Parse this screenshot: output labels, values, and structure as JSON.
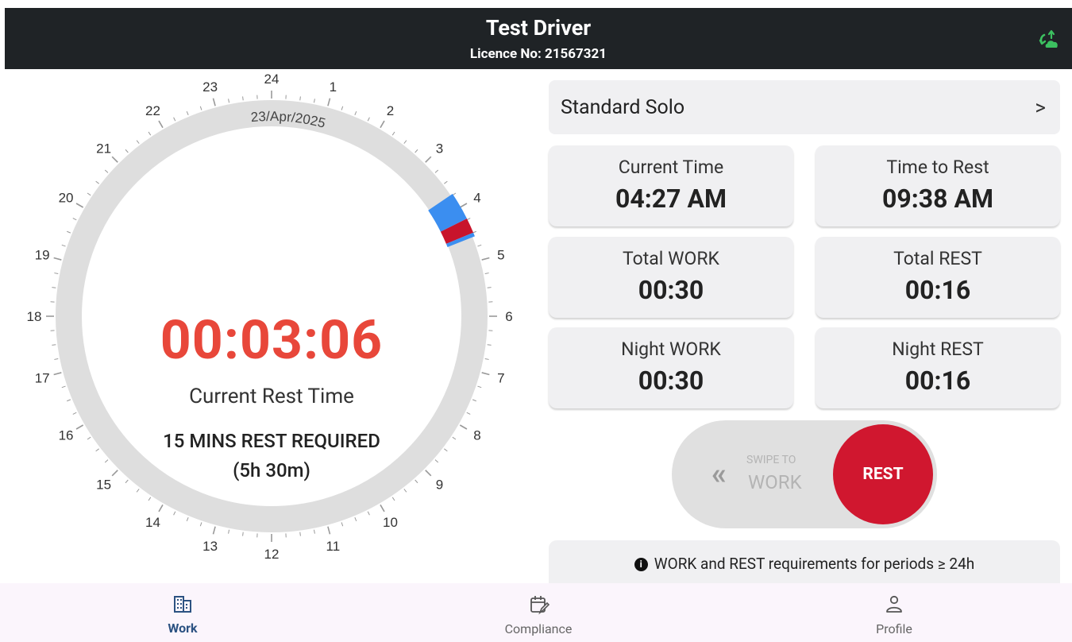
{
  "header": {
    "driver_name": "Test Driver",
    "licence": "Licence No: 21567321",
    "sync_icon": "cloud-sync-icon"
  },
  "dial": {
    "date": "23/Apr/2025",
    "hour_labels": [
      "24",
      "1",
      "2",
      "3",
      "4",
      "5",
      "6",
      "7",
      "8",
      "9",
      "10",
      "11",
      "12",
      "13",
      "14",
      "15",
      "16",
      "17",
      "18",
      "19",
      "20",
      "21",
      "22",
      "23"
    ],
    "ring_color": "#dedede",
    "work_color": "#3b8ef0",
    "rest_color": "#c8142c",
    "timer": "00:03:06",
    "timer_color": "#e8473a",
    "timer_caption": "Current Rest Time",
    "requirement_line1": "15 MINS REST REQUIRED",
    "requirement_line2": "(5h 30m)"
  },
  "rule": {
    "label": "Standard Solo",
    "chevron": ">"
  },
  "cards": [
    {
      "label": "Current Time",
      "value": "04:27 AM"
    },
    {
      "label": "Time to Rest",
      "value": "09:38 AM"
    },
    {
      "label": "Total WORK",
      "value": "00:30"
    },
    {
      "label": "Total REST",
      "value": "00:16"
    },
    {
      "label": "Night WORK",
      "value": "00:30"
    },
    {
      "label": "Night REST",
      "value": "00:16"
    }
  ],
  "swipe": {
    "arrows": "«",
    "hint_small": "SWIPE TO",
    "hint_large": "WORK",
    "button": "REST",
    "button_color": "#d0172f"
  },
  "info": {
    "icon": "i",
    "text": "WORK and REST requirements for periods ≥ 24h"
  },
  "nav": {
    "items": [
      {
        "label": "Work",
        "icon": "building-icon",
        "active": true
      },
      {
        "label": "Compliance",
        "icon": "calendar-edit-icon",
        "active": false
      },
      {
        "label": "Profile",
        "icon": "person-icon",
        "active": false
      }
    ]
  }
}
